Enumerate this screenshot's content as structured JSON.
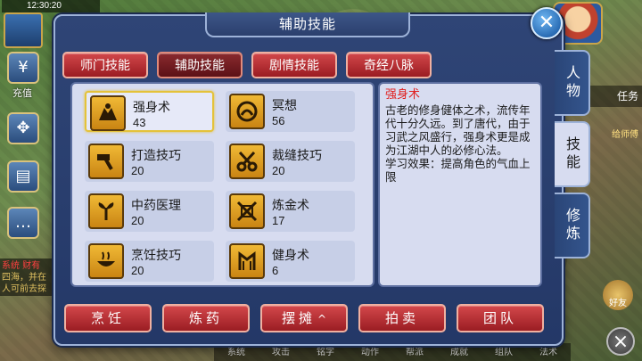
{
  "dialog": {
    "title": "辅助技能",
    "close_icon": "close-icon"
  },
  "tabs": [
    {
      "label": "师门技能",
      "active": false
    },
    {
      "label": "辅助技能",
      "active": true
    },
    {
      "label": "剧情技能",
      "active": false
    },
    {
      "label": "奇经八脉",
      "active": false
    }
  ],
  "skills": [
    {
      "name": "强身术",
      "level": "43",
      "icon": "strength-icon",
      "selected": true
    },
    {
      "name": "冥想",
      "level": "56",
      "icon": "meditation-icon",
      "selected": false
    },
    {
      "name": "打造技巧",
      "level": "20",
      "icon": "forging-icon",
      "selected": false
    },
    {
      "name": "裁缝技巧",
      "level": "20",
      "icon": "tailoring-icon",
      "selected": false
    },
    {
      "name": "中药医理",
      "level": "20",
      "icon": "herbal-medicine-icon",
      "selected": false
    },
    {
      "name": "炼金术",
      "level": "17",
      "icon": "alchemy-icon",
      "selected": false
    },
    {
      "name": "烹饪技巧",
      "level": "20",
      "icon": "cooking-icon",
      "selected": false
    },
    {
      "name": "健身术",
      "level": "6",
      "icon": "fitness-icon",
      "selected": false
    }
  ],
  "description": {
    "title": "强身术",
    "body": "古老的修身健体之术，流传年代十分久远。到了唐代，由于习武之风盛行，强身术更是成为江湖中人的必修心法。",
    "effect": "学习效果：提高角色的气血上限"
  },
  "buttons": [
    {
      "label": "烹饪"
    },
    {
      "label": "炼药"
    },
    {
      "label": "摆摊",
      "chevron": "^"
    },
    {
      "label": "拍卖"
    },
    {
      "label": "团队"
    }
  ],
  "side_tabs": [
    {
      "label": "人物",
      "active": false
    },
    {
      "label": "技能",
      "active": true
    },
    {
      "label": "修炼",
      "active": false
    }
  ],
  "hud": {
    "time": "12:30:20",
    "recharge": "充值",
    "task": "任务",
    "npc_label": "给师傅",
    "friend": "好友",
    "chat_line1": "系统 财有",
    "chat_line2": "四海，并在",
    "chat_line3": "人可前去探",
    "bottom_bar": [
      "系统",
      "攻击",
      "铭字",
      "动作",
      "帮派",
      "成就",
      "组队",
      "法术"
    ]
  }
}
